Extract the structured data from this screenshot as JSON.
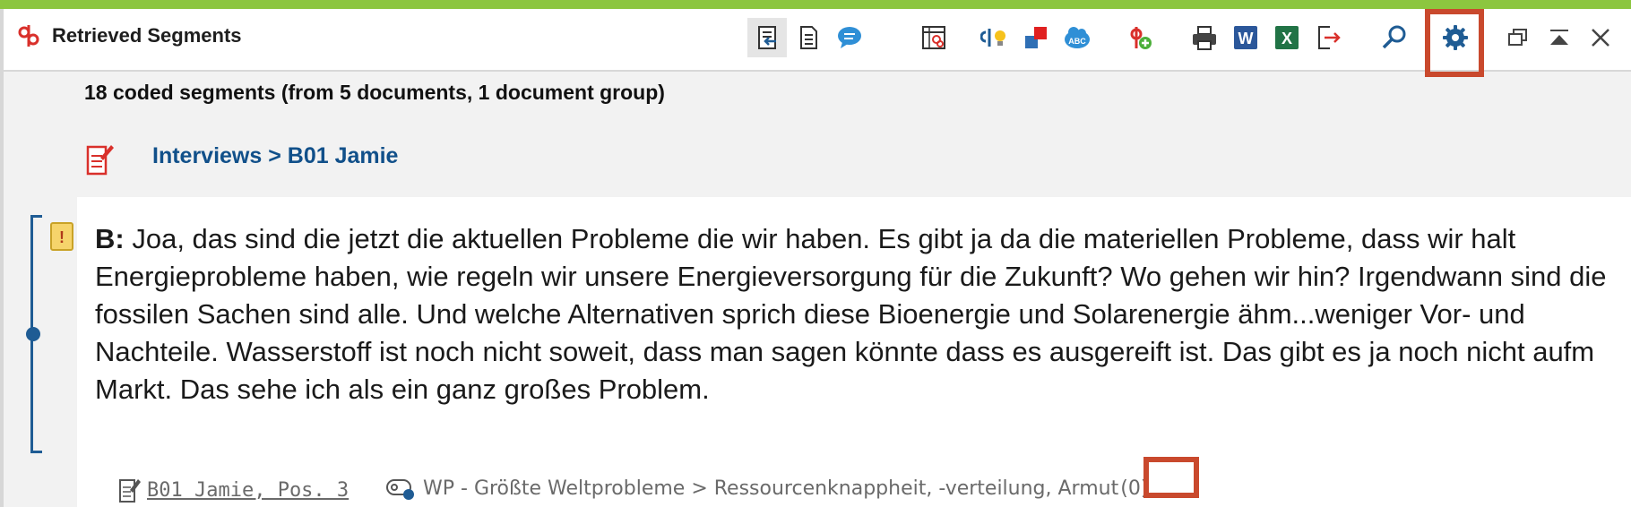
{
  "window": {
    "title": "Retrieved Segments"
  },
  "toolbar": {
    "icons": [
      "export-to-document-icon",
      "list-view-icon",
      "comment-bubble-icon",
      "code-matrix-icon",
      "code-idea-icon",
      "color-code-icon",
      "word-cloud-icon",
      "add-code-icon",
      "print-icon",
      "word-export-icon",
      "excel-export-icon",
      "export-arrow-icon",
      "search-icon",
      "settings-icon",
      "restore-window-icon",
      "collapse-icon",
      "close-icon"
    ],
    "word_label": "W",
    "excel_label": "X",
    "abc_label": "ABC"
  },
  "summary": "18 coded segments (from 5 documents, 1 document group)",
  "document": {
    "path": "Interviews > B01 Jamie"
  },
  "segment": {
    "speaker": "B:",
    "text": " Joa, das sind die jetzt die aktuellen Probleme die wir haben. Es gibt ja da die materiellen Probleme, dass wir halt Energieprobleme haben, wie regeln wir unsere Energieversorgung für die Zukunft? Wo gehen wir hin? Irgendwann sind die fossilen Sachen sind alle. Und welche Alternativen sprich diese Bioenergie und Solarenergie ähm...weniger Vor- und Nachteile. Wasserstoff ist noch nicht soweit, dass man sagen könnte dass es ausgereift ist. Das gibt es ja noch nicht aufm Markt. Das sehe ich als ein ganz großes Problem.",
    "memo_symbol": "!",
    "source": "B01 Jamie, Pos. 3",
    "code": "WP - Größte Weltprobleme > Ressourcenknappheit, -verteilung, Armut",
    "code_count": "(0)"
  },
  "colors": {
    "accent_bar": "#8cc63f",
    "link_blue": "#11508a",
    "highlight": "#c9492d",
    "bracket": "#1f5c94"
  }
}
